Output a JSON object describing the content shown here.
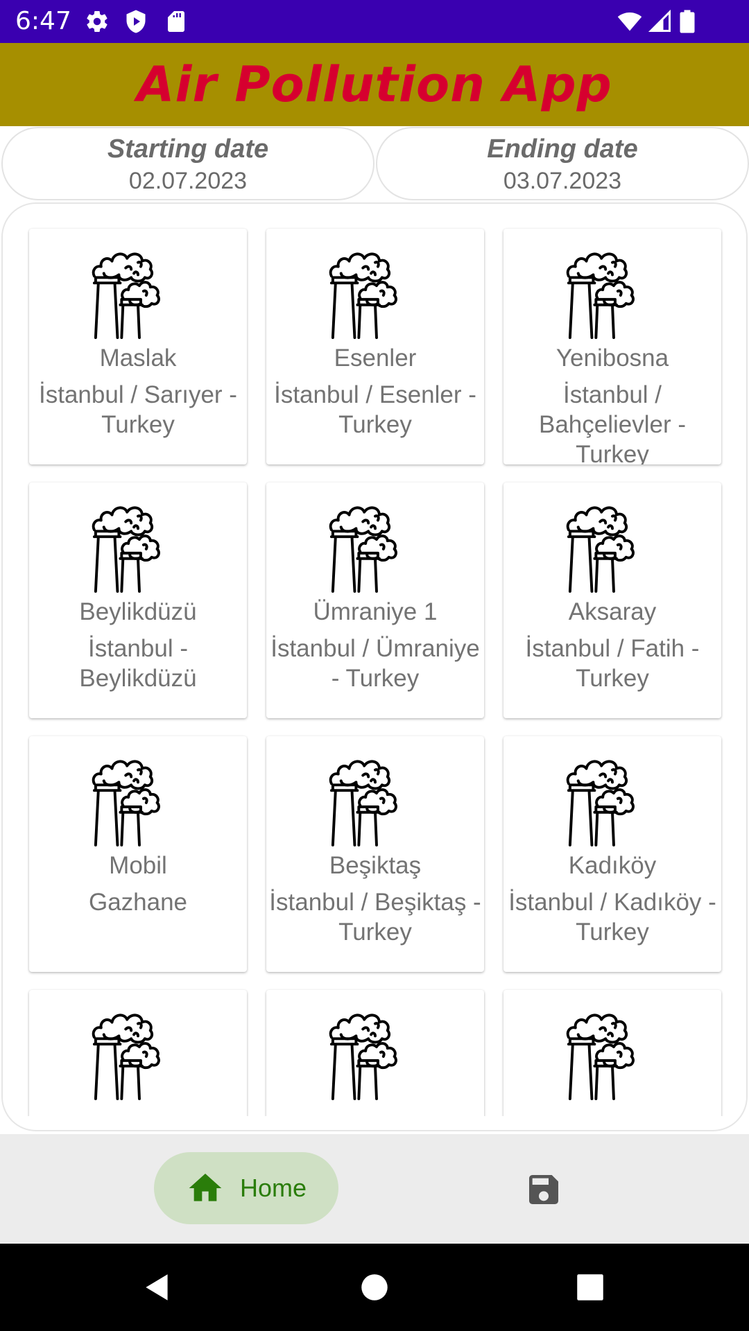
{
  "status_bar": {
    "time": "6:47",
    "left_icons": [
      "settings-icon",
      "shield-play-icon",
      "sd-card-icon"
    ],
    "right_icons": [
      "wifi-icon",
      "cell-signal-icon",
      "battery-icon"
    ],
    "background": "#3a00b0"
  },
  "app_bar": {
    "title": "Air Pollution App",
    "background": "#a68f00",
    "title_color": "#d6002f"
  },
  "dates": {
    "start_label": "Starting date",
    "start_value": "02.07.2023",
    "end_label": "Ending date",
    "end_value": "03.07.2023"
  },
  "stations": [
    {
      "name": "Maslak",
      "location": "İstanbul / Sarıyer - Turkey",
      "icon": "factory-pollution-icon"
    },
    {
      "name": "Esenler",
      "location": "İstanbul / Esenler - Turkey",
      "icon": "factory-pollution-icon"
    },
    {
      "name": "Yenibosna",
      "location": "İstanbul / Bahçelievler - Turkey",
      "icon": "factory-pollution-icon"
    },
    {
      "name": "Beylikdüzü",
      "location": "İstanbul - Beylikdüzü",
      "icon": "factory-pollution-icon"
    },
    {
      "name": "Ümraniye 1",
      "location": "İstanbul / Ümraniye - Turkey",
      "icon": "factory-pollution-icon"
    },
    {
      "name": "Aksaray",
      "location": "İstanbul / Fatih - Turkey",
      "icon": "factory-pollution-icon"
    },
    {
      "name": "Mobil",
      "location": "Gazhane",
      "icon": "factory-pollution-icon"
    },
    {
      "name": "Beşiktaş",
      "location": "İstanbul / Beşiktaş - Turkey",
      "icon": "factory-pollution-icon"
    },
    {
      "name": "Kadıköy",
      "location": "İstanbul / Kadıköy - Turkey",
      "icon": "factory-pollution-icon"
    },
    {
      "name": "",
      "location": "",
      "icon": "factory-pollution-icon"
    },
    {
      "name": "",
      "location": "",
      "icon": "factory-pollution-icon"
    },
    {
      "name": "",
      "location": "",
      "icon": "factory-pollution-icon"
    }
  ],
  "bottom_nav": {
    "home_label": "Home",
    "home_icon": "home-icon",
    "save_icon": "save-icon",
    "active_color": "#2a7d0a"
  },
  "system_nav": {
    "icons": [
      "back-icon",
      "home-circle-icon",
      "recents-icon"
    ]
  }
}
